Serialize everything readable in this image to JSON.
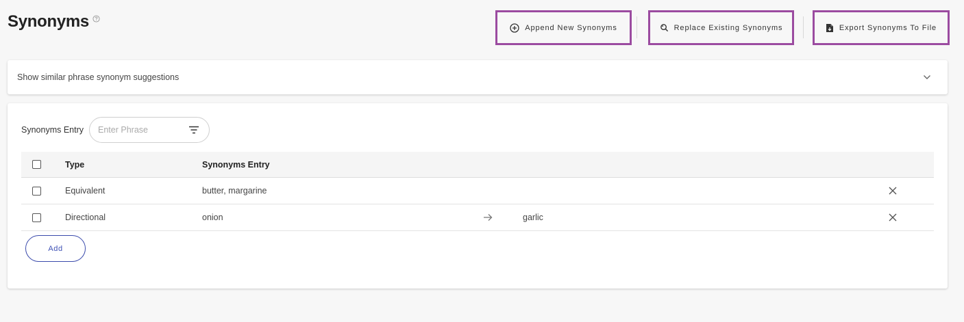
{
  "header": {
    "title": "Synonyms",
    "help_icon": "question-circle-icon"
  },
  "actions": {
    "append_label": "Append New Synonyms",
    "replace_label": "Replace Existing Synonyms",
    "export_label": "Export Synonyms To File",
    "highlight_color": "#9b4ba0"
  },
  "suggestions": {
    "label": "Show similar phrase synonym suggestions",
    "icon": "chevron-down-icon"
  },
  "entry": {
    "label": "Synonyms Entry",
    "placeholder": "Enter Phrase",
    "filter_icon": "filter-icon"
  },
  "table": {
    "headers": {
      "type": "Type",
      "entry": "Synonyms Entry"
    },
    "rows": [
      {
        "type": "Equivalent",
        "entry": "butter, margarine",
        "target": ""
      },
      {
        "type": "Directional",
        "entry": "onion",
        "target": "garlic"
      }
    ]
  },
  "add_label": "Add",
  "colors": {
    "accent": "#3f51b5",
    "background": "#f7f7f7"
  }
}
